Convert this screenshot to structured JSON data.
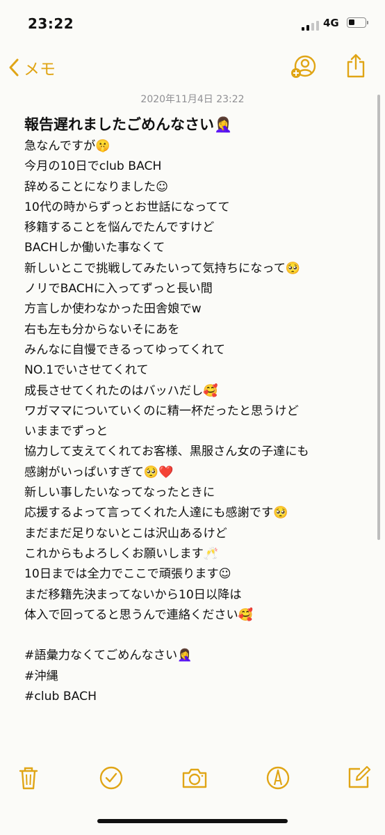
{
  "status_bar": {
    "time": "23:22",
    "network": "4G",
    "signal_bars_active": 2,
    "battery_level": 0.3
  },
  "nav": {
    "back_label": "メモ",
    "back_icon": "chevron-left-icon",
    "share_person_icon": "person-add-icon",
    "share_icon": "share-icon",
    "accent_color": "#e0a516"
  },
  "note": {
    "date": "2020年11月4日 23:22",
    "title": "報告遅れましたごめんなさい🤦‍♀️",
    "lines": [
      "急なんですが🤫",
      "今月の10日でclub BACH",
      "辞めることになりました☺︎",
      "10代の時からずっとお世話になってて",
      "移籍することを悩んでたんですけど",
      "BACHしか働いた事なくて",
      "新しいとこで挑戦してみたいって気持ちになって🥺",
      "ノリでBACHに入ってずっと長い間",
      "方言しか使わなかった田舎娘でw",
      "右も左も分からないそにあを",
      "みんなに自慢できるってゆってくれて",
      "NO.1でいさせてくれて",
      "成長させてくれたのはバッハだし🥰",
      "ワガママについていくのに精一杯だったと思うけど",
      "いままでずっと",
      "協力して支えてくれてお客様、黒服さん女の子達にも",
      "感謝がいっぱいすぎて🥺❤️",
      "新しい事したいなってなったときに",
      "応援するよって言ってくれた人達にも感謝です🥺",
      "まだまだ足りないとこは沢山あるけど",
      "これからもよろしくお願いします🥂",
      "10日までは全力でここで頑張ります☺︎",
      "まだ移籍先決まってないから10日以降は",
      "体入で回ってると思うんで連絡ください🥰",
      "",
      "#語彙力なくてごめんなさい🤦‍♀️",
      "#沖縄",
      "#club BACH"
    ]
  },
  "toolbar": {
    "icons": [
      "trash-icon",
      "checklist-icon",
      "camera-icon",
      "markup-pen-icon",
      "compose-icon"
    ]
  }
}
